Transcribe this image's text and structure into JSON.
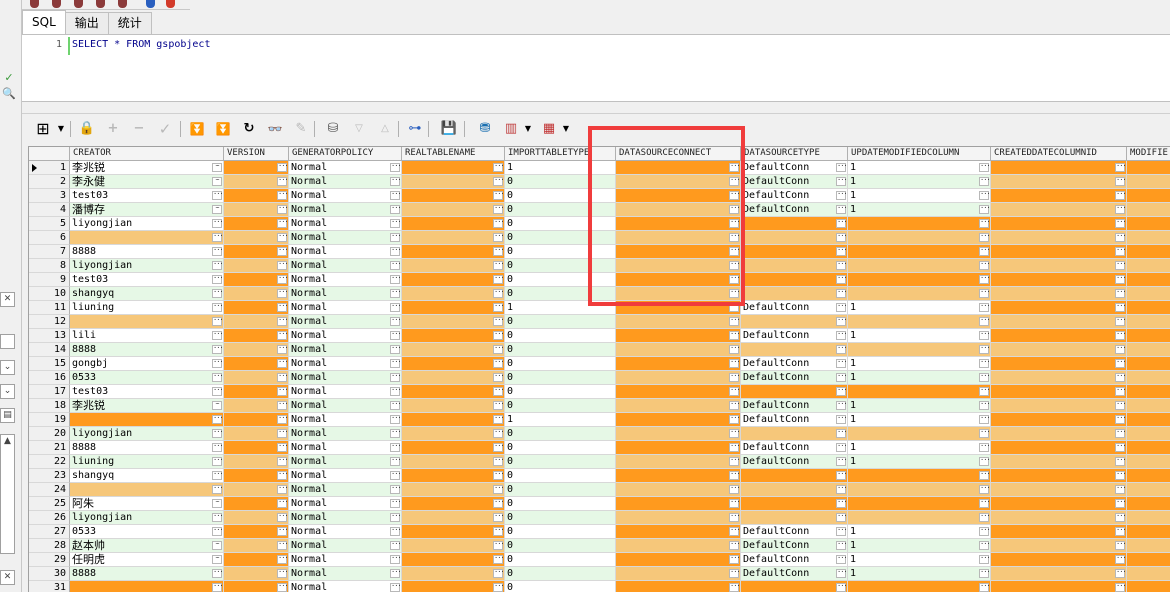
{
  "tabs": [
    {
      "label": "SQL",
      "active": true
    },
    {
      "label": "输出",
      "active": false
    },
    {
      "label": "统计",
      "active": false
    }
  ],
  "editor": {
    "line_number": "1",
    "sql": "SELECT * FROM gspobject"
  },
  "colors": {
    "null_even": "#ff9a1e",
    "null_odd": "#f6c77a",
    "value_even": "#ffffff",
    "value_odd": "#e6f8e6",
    "highlight": "#f03c3c"
  },
  "grid": {
    "columns": [
      "CREATOR",
      "VERSION",
      "GENERATORPOLICY",
      "REALTABLENAME",
      "IMPORTTABLETYPE",
      "DATASOURCECONNECT",
      "DATASOURCETYPE",
      "UPDATEMODIFIEDCOLUMN",
      "CREATEDDATECOLUMNID",
      "MODIFIE"
    ],
    "rows": [
      [
        "1",
        "李兆锐",
        "",
        "Normal",
        "",
        "1",
        "",
        "DefaultConn",
        "1",
        "",
        ""
      ],
      [
        "2",
        "李永健",
        "",
        "Normal",
        "",
        "0",
        "",
        "DefaultConn",
        "1",
        "",
        ""
      ],
      [
        "3",
        "test03",
        "",
        "Normal",
        "",
        "0",
        "",
        "DefaultConn",
        "1",
        "",
        ""
      ],
      [
        "4",
        "潘博存",
        "",
        "Normal",
        "",
        "0",
        "",
        "DefaultConn",
        "1",
        "",
        ""
      ],
      [
        "5",
        "liyongjian",
        "",
        "Normal",
        "",
        "0",
        "",
        "",
        "",
        "",
        ""
      ],
      [
        "6",
        "",
        "",
        "Normal",
        "",
        "0",
        "",
        "",
        "",
        "",
        ""
      ],
      [
        "7",
        "8888",
        "",
        "Normal",
        "",
        "0",
        "",
        "",
        "",
        "",
        ""
      ],
      [
        "8",
        "liyongjian",
        "",
        "Normal",
        "",
        "0",
        "",
        "",
        "",
        "",
        ""
      ],
      [
        "9",
        "test03",
        "",
        "Normal",
        "",
        "0",
        "",
        "",
        "",
        "",
        ""
      ],
      [
        "10",
        "shangyq",
        "",
        "Normal",
        "",
        "0",
        "",
        "",
        "",
        "",
        ""
      ],
      [
        "11",
        "liuning",
        "",
        "Normal",
        "",
        "1",
        "",
        "DefaultConn",
        "1",
        "",
        ""
      ],
      [
        "12",
        "",
        "",
        "Normal",
        "",
        "0",
        "",
        "",
        "",
        "",
        ""
      ],
      [
        "13",
        "lili",
        "",
        "Normal",
        "",
        "0",
        "",
        "DefaultConn",
        "1",
        "",
        ""
      ],
      [
        "14",
        "8888",
        "",
        "Normal",
        "",
        "0",
        "",
        "",
        "",
        "",
        ""
      ],
      [
        "15",
        "gongbj",
        "",
        "Normal",
        "",
        "0",
        "",
        "DefaultConn",
        "1",
        "",
        ""
      ],
      [
        "16",
        "0533",
        "",
        "Normal",
        "",
        "0",
        "",
        "DefaultConn",
        "1",
        "",
        ""
      ],
      [
        "17",
        "test03",
        "",
        "Normal",
        "",
        "0",
        "",
        "",
        "",
        "",
        ""
      ],
      [
        "18",
        "李兆锐",
        "",
        "Normal",
        "",
        "0",
        "",
        "DefaultConn",
        "1",
        "",
        ""
      ],
      [
        "19",
        "",
        "",
        "Normal",
        "",
        "1",
        "",
        "DefaultConn",
        "1",
        "",
        ""
      ],
      [
        "20",
        "liyongjian",
        "",
        "Normal",
        "",
        "0",
        "",
        "",
        "",
        "",
        ""
      ],
      [
        "21",
        "8888",
        "",
        "Normal",
        "",
        "0",
        "",
        "DefaultConn",
        "1",
        "",
        ""
      ],
      [
        "22",
        "liuning",
        "",
        "Normal",
        "",
        "0",
        "",
        "DefaultConn",
        "1",
        "",
        ""
      ],
      [
        "23",
        "shangyq",
        "",
        "Normal",
        "",
        "0",
        "",
        "",
        "",
        "",
        ""
      ],
      [
        "24",
        "",
        "",
        "Normal",
        "",
        "0",
        "",
        "",
        "",
        "",
        ""
      ],
      [
        "25",
        "阿朱",
        "",
        "Normal",
        "",
        "0",
        "",
        "",
        "",
        "",
        ""
      ],
      [
        "26",
        "liyongjian",
        "",
        "Normal",
        "",
        "0",
        "",
        "",
        "",
        "",
        ""
      ],
      [
        "27",
        "0533",
        "",
        "Normal",
        "",
        "0",
        "",
        "DefaultConn",
        "1",
        "",
        ""
      ],
      [
        "28",
        "赵本帅",
        "",
        "Normal",
        "",
        "0",
        "",
        "DefaultConn",
        "1",
        "",
        ""
      ],
      [
        "29",
        "任明虎",
        "",
        "Normal",
        "",
        "0",
        "",
        "DefaultConn",
        "1",
        "",
        ""
      ],
      [
        "30",
        "8888",
        "",
        "Normal",
        "",
        "0",
        "",
        "DefaultConn",
        "1",
        "",
        ""
      ],
      [
        "31",
        "",
        "",
        "Normal",
        "",
        "0",
        "",
        "",
        "",
        "",
        ""
      ]
    ]
  },
  "toolbar_icons": [
    "grid-options-icon",
    "lock-icon",
    "add-record-icon",
    "delete-record-icon",
    "post-record-icon",
    "fetch-next-icon",
    "fetch-last-icon",
    "refresh-icon",
    "find-icon",
    "clear-icon",
    "query-by-example-icon",
    "filter-icon",
    "previous-icon",
    "next-icon",
    "explain-plan-icon",
    "save-icon",
    "export-icon",
    "chart-icon",
    "single-record-icon"
  ]
}
